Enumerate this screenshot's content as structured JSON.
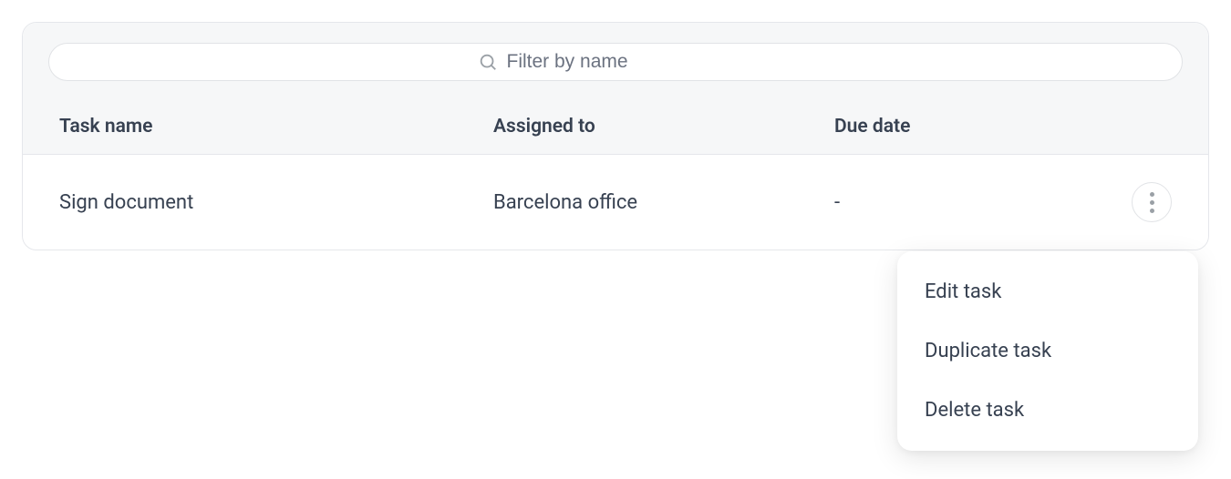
{
  "filter": {
    "placeholder": "Filter by name"
  },
  "table": {
    "headers": {
      "task_name": "Task name",
      "assigned_to": "Assigned to",
      "due_date": "Due date"
    },
    "rows": [
      {
        "task_name": "Sign document",
        "assigned_to": "Barcelona office",
        "due_date": "-"
      }
    ]
  },
  "menu": {
    "items": [
      {
        "label": "Edit task"
      },
      {
        "label": "Duplicate task"
      },
      {
        "label": "Delete task"
      }
    ]
  }
}
